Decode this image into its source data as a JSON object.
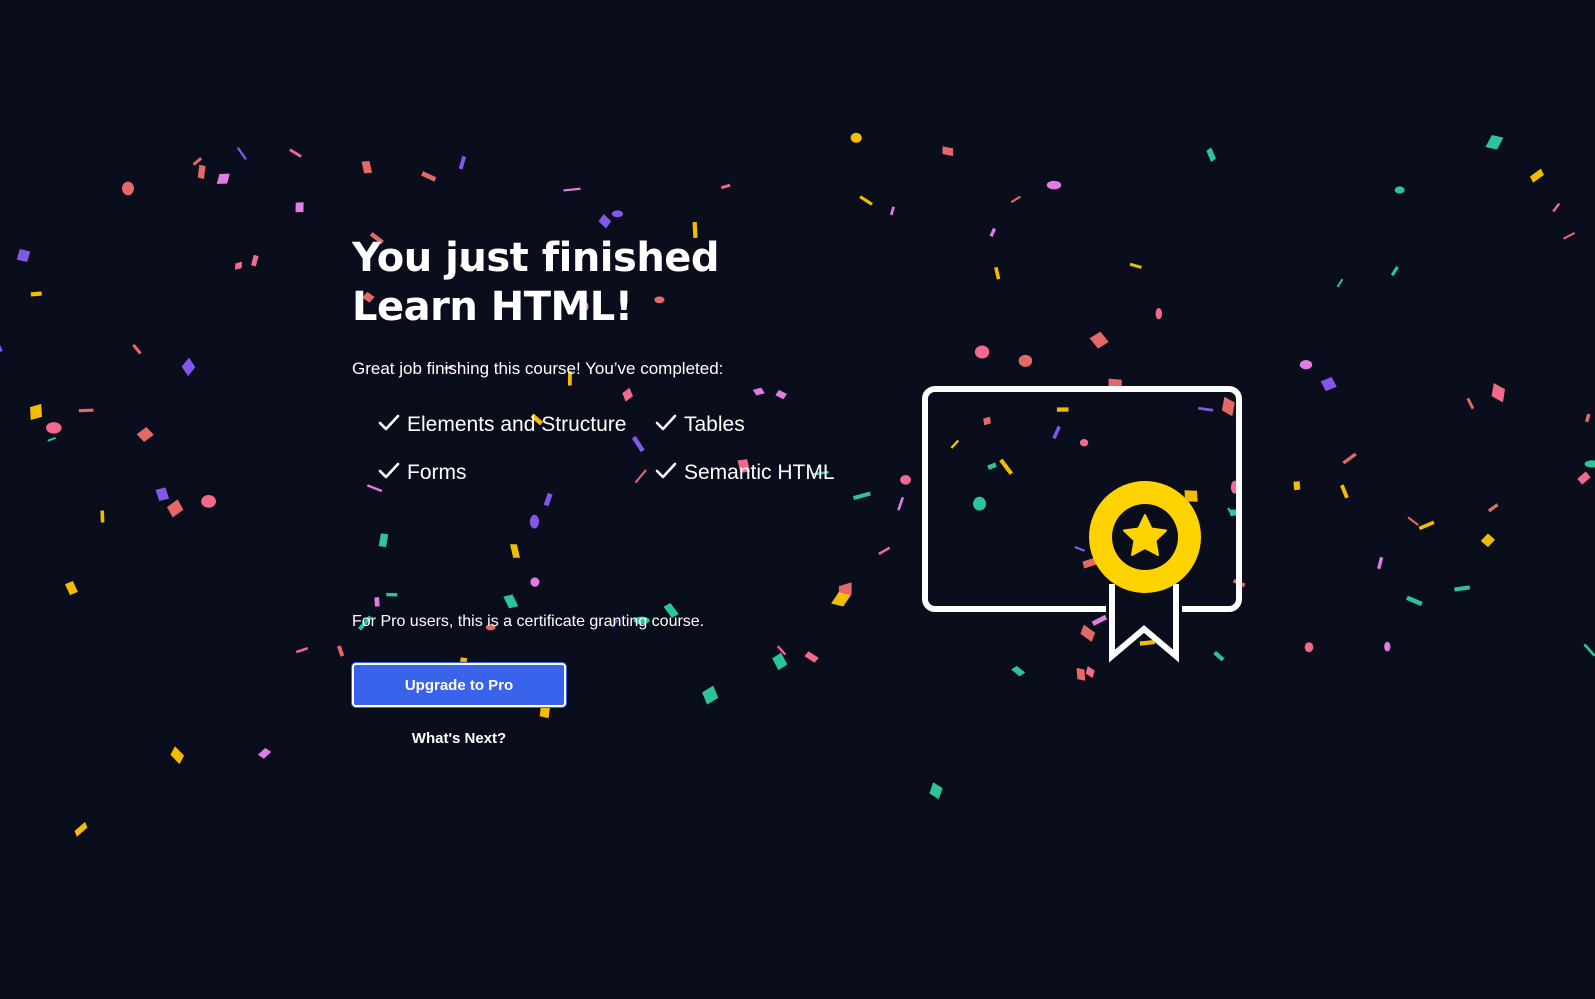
{
  "course_complete": {
    "headline": "You just finished Learn HTML!",
    "intro": "Great job finishing this course! You’ve completed:",
    "lessons": [
      "Elements and Structure",
      "Tables",
      "Forms",
      "Semantic HTML"
    ],
    "pro_note": "For Pro users, this is a certificate granting course.",
    "upgrade_label": "Upgrade to Pro",
    "next_label": "What's Next?"
  },
  "colors": {
    "background": "#0a0d1c",
    "text": "#ffffff",
    "button": "#3a63ec",
    "medal": "#ffd300",
    "confetti": [
      "#ef6f6c",
      "#ee82ee",
      "#8b5cf6",
      "#ffc700",
      "#2ecfa0",
      "#ff6f91"
    ]
  },
  "icons": {
    "check": "check-icon",
    "certificate": "certificate-icon",
    "medal": "star-medal-icon"
  }
}
